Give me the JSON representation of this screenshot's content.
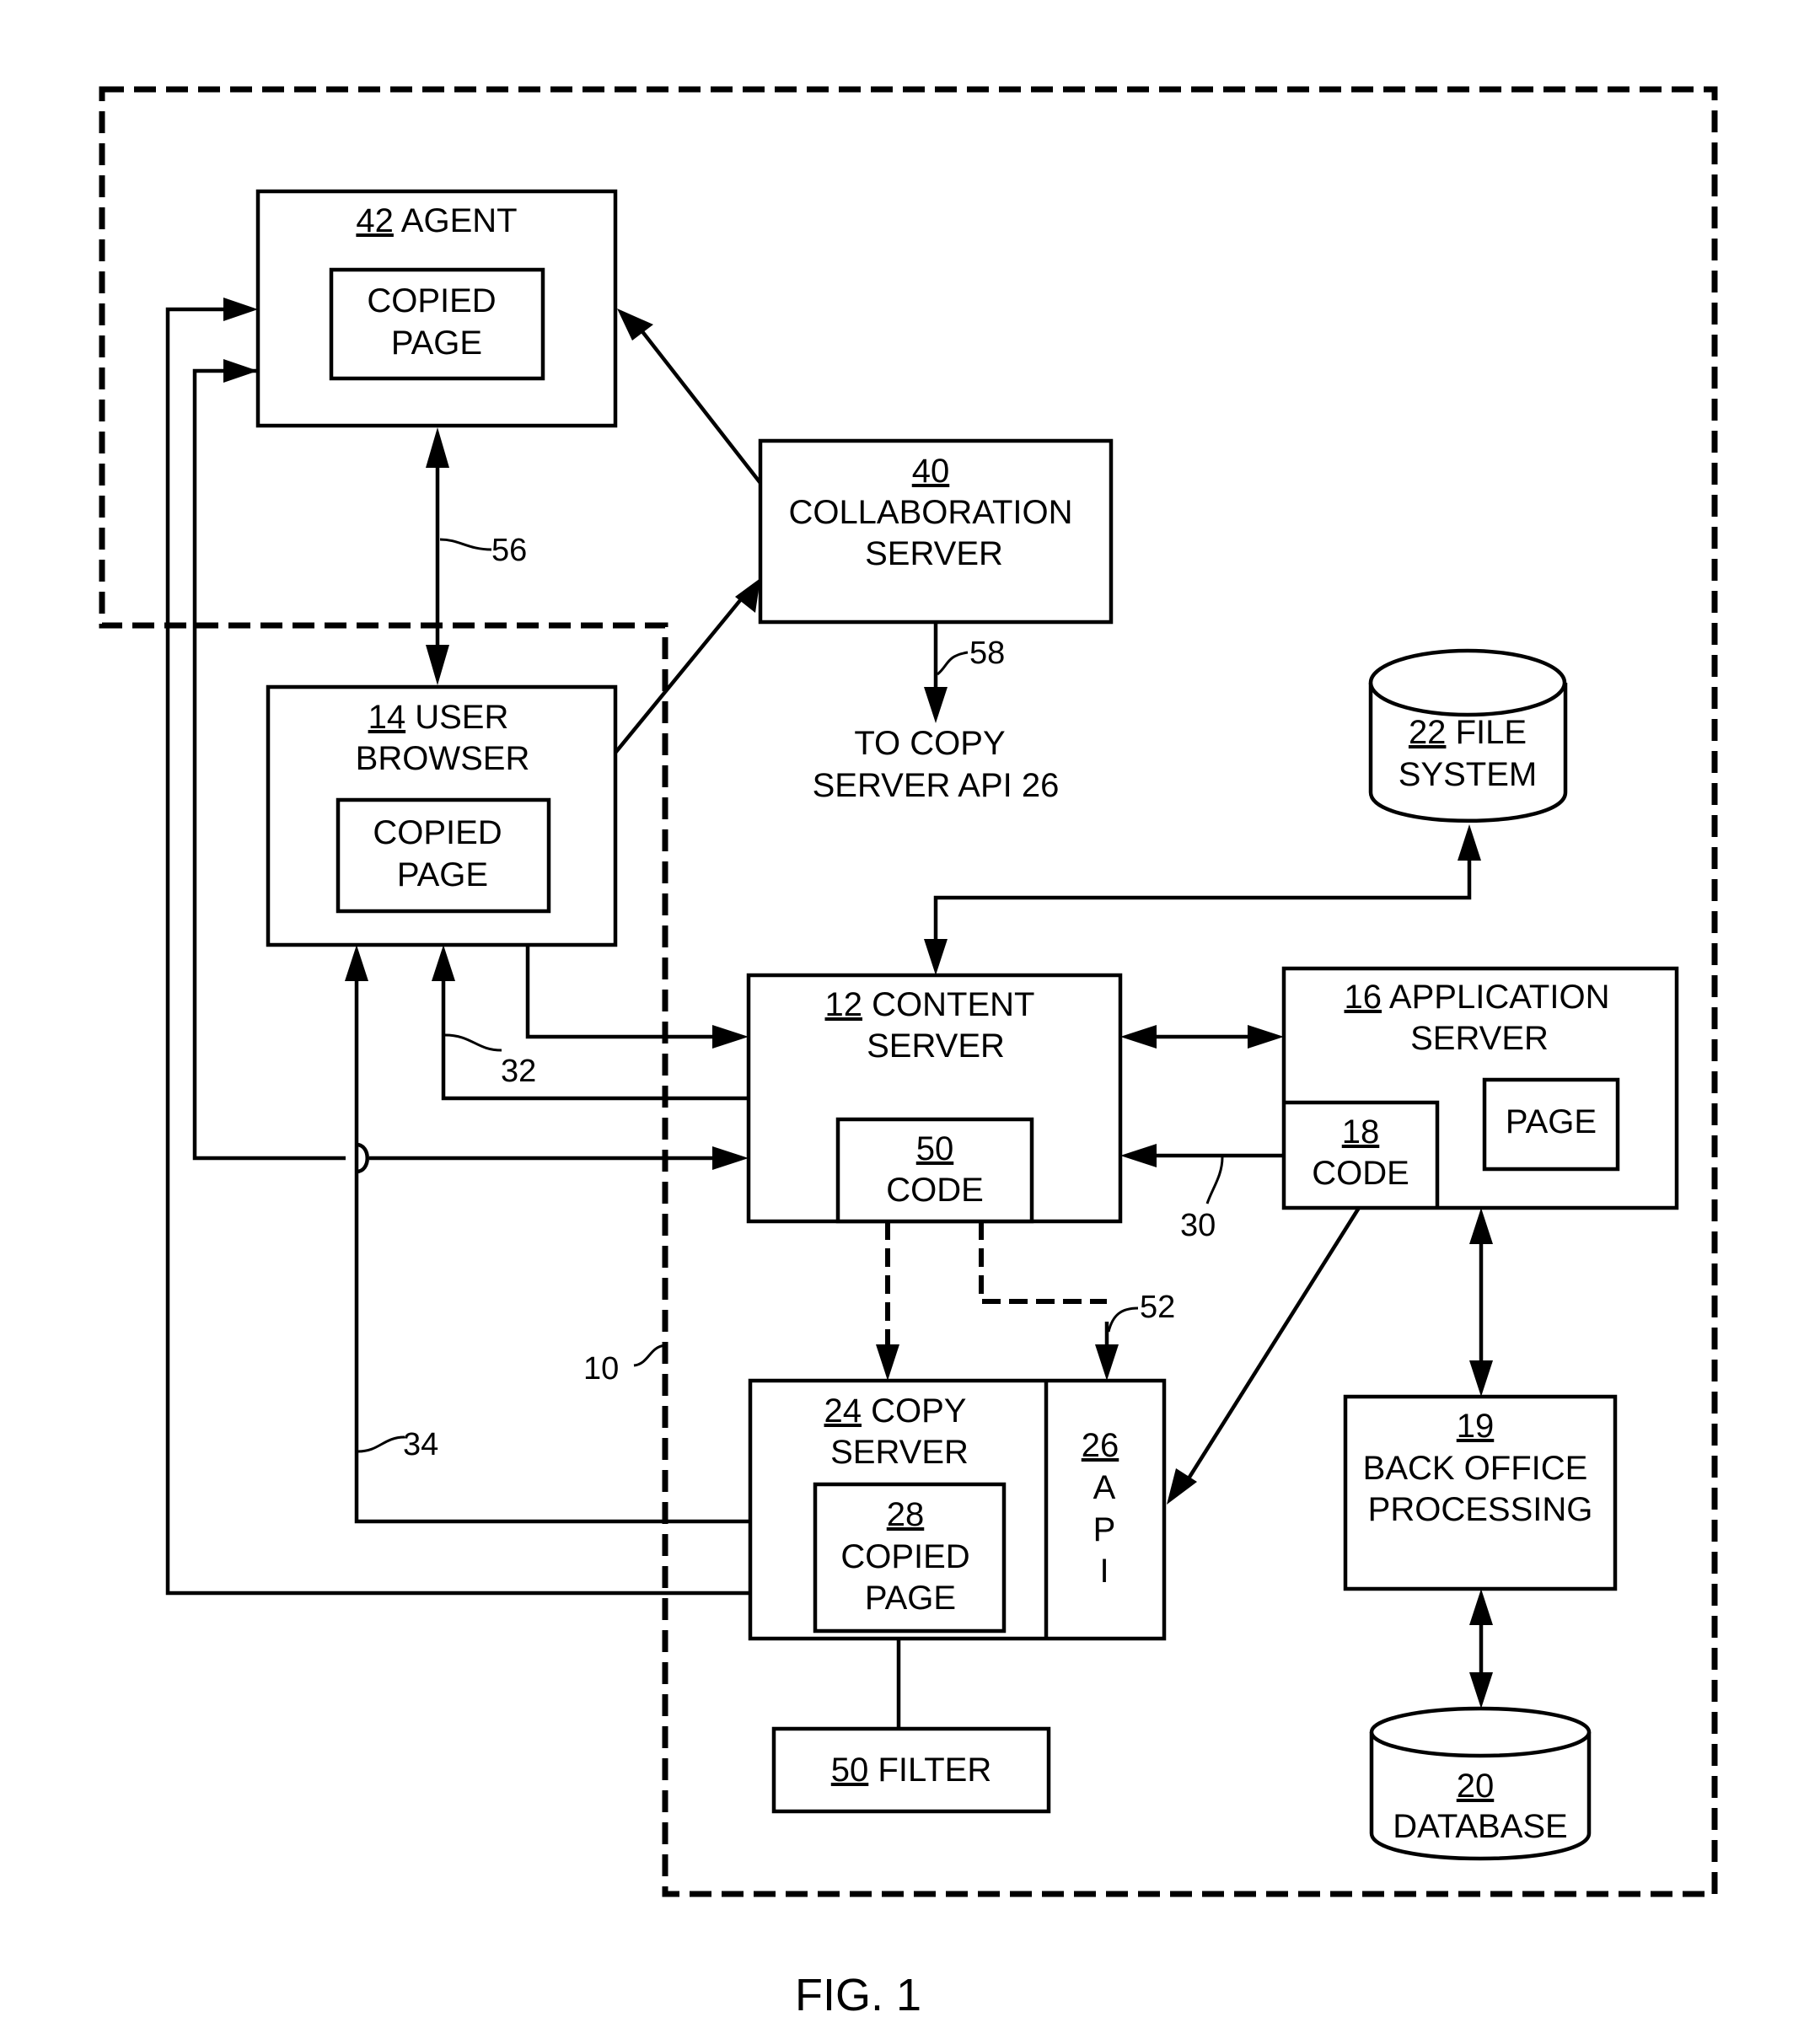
{
  "figure": {
    "caption": "FIG. 1",
    "system_ref": "10"
  },
  "nodes": {
    "agent": {
      "ref": "42",
      "label": "AGENT",
      "inner": [
        "COPIED",
        "PAGE"
      ]
    },
    "collaboration_server": {
      "ref": "40",
      "lines": [
        "COLLABORATION",
        "SERVER"
      ]
    },
    "user_browser": {
      "ref": "14",
      "label": "USER",
      "line2": "BROWSER",
      "inner": [
        "COPIED",
        "PAGE"
      ]
    },
    "content_server": {
      "ref": "12",
      "label": "CONTENT",
      "line2": "SERVER",
      "code": {
        "ref": "50",
        "label": "CODE"
      }
    },
    "application_server": {
      "ref": "16",
      "label": "APPLICATION",
      "line2": "SERVER",
      "code": {
        "ref": "18",
        "label": "CODE"
      },
      "page": "PAGE"
    },
    "file_system": {
      "ref": "22",
      "label": "FILE",
      "line2": "SYSTEM"
    },
    "copy_server": {
      "ref": "24",
      "label": "COPY",
      "line2": "SERVER",
      "copied_page": {
        "ref": "28",
        "lines": [
          "COPIED",
          "PAGE"
        ]
      }
    },
    "api": {
      "ref": "26",
      "letters": [
        "A",
        "P",
        "I"
      ]
    },
    "filter": {
      "ref": "50",
      "label": "FILTER"
    },
    "back_office": {
      "ref": "19",
      "lines": [
        "BACK OFFICE",
        "PROCESSING"
      ]
    },
    "database": {
      "ref": "20",
      "label": "DATABASE"
    }
  },
  "connections": {
    "agent_browser": "56",
    "collab_out": "58",
    "collab_out_text": [
      "TO COPY",
      "SERVER API 26"
    ],
    "content_to_browser": "32",
    "app_to_content": "30",
    "copy_to_browser": "34",
    "code_to_api": "52"
  }
}
